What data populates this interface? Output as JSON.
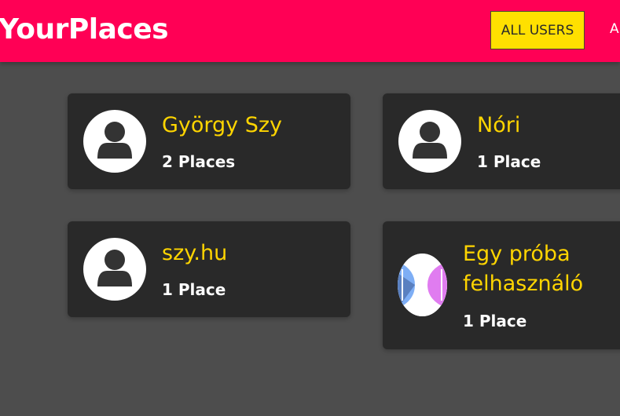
{
  "header": {
    "title": "YourPlaces",
    "nav": [
      {
        "label": "ALL USERS"
      },
      {
        "label": "A"
      }
    ]
  },
  "users": [
    {
      "name": "György Szy",
      "places": "2 Places",
      "avatar": "default-user-icon"
    },
    {
      "name": "Nóri",
      "places": "1 Place",
      "avatar": "default-user-icon"
    },
    {
      "name": "szy.hu",
      "places": "1 Place",
      "avatar": "default-user-icon"
    },
    {
      "name_lines": [
        "Egy próba",
        "felhasználó"
      ],
      "places": "1 Place",
      "avatar": "image"
    }
  ],
  "colors": {
    "header": "#ff0055",
    "accent": "#ffd500",
    "card": "#292929",
    "bg": "#4d4d4d"
  }
}
